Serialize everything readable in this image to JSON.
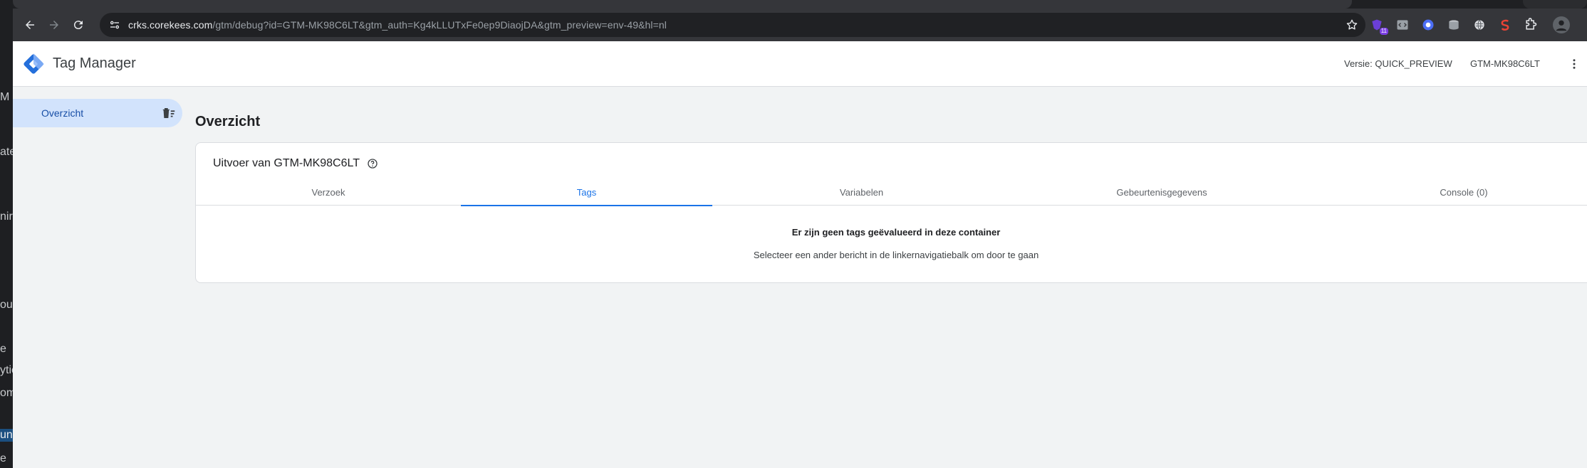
{
  "background_window": {
    "fragments": [
      "M",
      "ate",
      "nir",
      "our",
      "e",
      "ytic",
      "om",
      "uni",
      "e"
    ]
  },
  "browser": {
    "url_host": "crks.corekees.com",
    "url_path": "/gtm/debug?id=GTM-MK98C6LT&gtm_auth=Kg4kLLUTxFe0ep9DiaojDA&gtm_preview=env-49&hl=nl",
    "extension_badge": "11",
    "icons": [
      "back-arrow-icon",
      "forward-arrow-icon",
      "reload-icon",
      "site-settings-icon",
      "bookmark-star-icon",
      "puzzle-extensions-icon"
    ]
  },
  "header": {
    "product_name": "Tag Manager",
    "version_label": "Versie: QUICK_PREVIEW",
    "container_id": "GTM-MK98C6LT"
  },
  "sidebar": {
    "items": [
      {
        "label": "Overzicht"
      }
    ]
  },
  "main": {
    "title": "Overzicht",
    "card_title": "Uitvoer van GTM-MK98C6LT",
    "tabs": [
      {
        "label": "Verzoek"
      },
      {
        "label": "Tags"
      },
      {
        "label": "Variabelen"
      },
      {
        "label": "Gebeurtenisgegevens"
      },
      {
        "label": "Console (0)"
      }
    ],
    "active_tab": "Tags",
    "empty_title": "Er zijn geen tags geëvalueerd in deze container",
    "empty_subtitle": "Selecteer een ander bericht in de linkernavigatiebalk om door te gaan"
  },
  "colors": {
    "accent": "#1a73e8",
    "sidebar_selected": "#d2e3fc",
    "chrome_toolbar": "#35363a"
  }
}
